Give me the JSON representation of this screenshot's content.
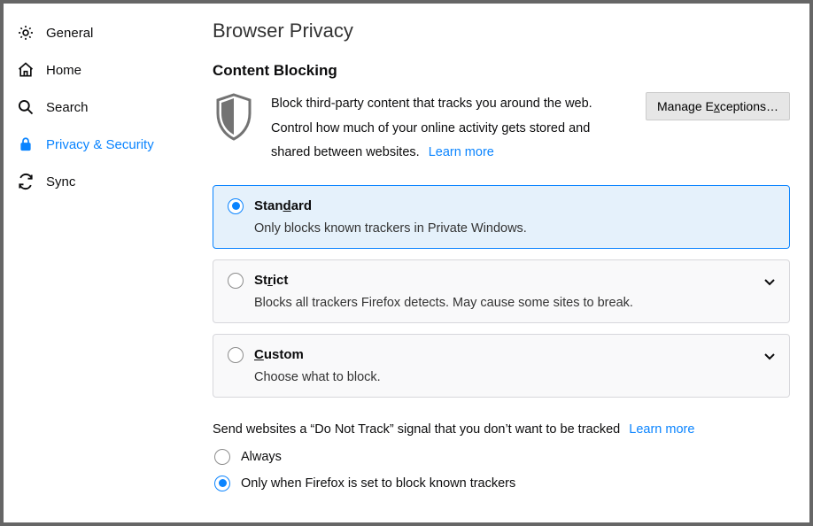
{
  "sidebar": {
    "items": [
      {
        "label": "General",
        "icon": "gear"
      },
      {
        "label": "Home",
        "icon": "home"
      },
      {
        "label": "Search",
        "icon": "search"
      },
      {
        "label": "Privacy & Security",
        "icon": "lock"
      },
      {
        "label": "Sync",
        "icon": "sync"
      }
    ]
  },
  "page": {
    "title": "Browser Privacy"
  },
  "content_blocking": {
    "heading": "Content Blocking",
    "description": "Block third-party content that tracks you around the web. Control how much of your online activity gets stored and shared between websites.",
    "learn_more": "Learn more",
    "manage_exceptions_prefix": "Manage E",
    "manage_exceptions_key": "x",
    "manage_exceptions_suffix": "ceptions…",
    "options": [
      {
        "title_prefix": "Stan",
        "title_key": "d",
        "title_suffix": "ard",
        "desc": "Only blocks known trackers in Private Windows.",
        "selected": true,
        "expandable": false
      },
      {
        "title_prefix": "St",
        "title_key": "r",
        "title_suffix": "ict",
        "desc": "Blocks all trackers Firefox detects. May cause some sites to break.",
        "selected": false,
        "expandable": true
      },
      {
        "title_prefix": "",
        "title_key": "C",
        "title_suffix": "ustom",
        "desc": "Choose what to block.",
        "selected": false,
        "expandable": true
      }
    ]
  },
  "dnt": {
    "label": "Send websites a “Do Not Track” signal that you don’t want to be tracked",
    "learn_more": "Learn more",
    "options": [
      {
        "label": "Always",
        "selected": false
      },
      {
        "label": "Only when Firefox is set to block known trackers",
        "selected": true
      }
    ]
  }
}
